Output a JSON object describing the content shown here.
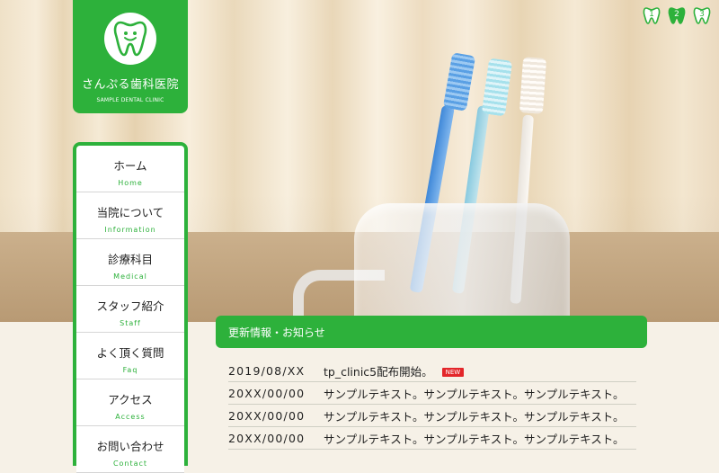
{
  "clinic": {
    "name": "さんぷる歯科医院",
    "subtitle": "SAMPLE DENTAL CLINIC"
  },
  "slider": {
    "pages": [
      "1",
      "2",
      "3"
    ],
    "active_index": 1
  },
  "nav": {
    "items": [
      {
        "jp": "ホーム",
        "en": "Home"
      },
      {
        "jp": "当院について",
        "en": "Information"
      },
      {
        "jp": "診療科目",
        "en": "Medical"
      },
      {
        "jp": "スタッフ紹介",
        "en": "Staff"
      },
      {
        "jp": "よく頂く質問",
        "en": "Faq"
      },
      {
        "jp": "アクセス",
        "en": "Access"
      },
      {
        "jp": "お問い合わせ",
        "en": "Contact"
      }
    ]
  },
  "news": {
    "title": "更新情報・お知らせ",
    "badge": "NEW",
    "items": [
      {
        "date": "2019/08/XX",
        "text": "tp_clinic5配布開始。",
        "is_new": true
      },
      {
        "date": "20XX/00/00",
        "text": "サンプルテキスト。サンプルテキスト。サンプルテキスト。",
        "is_new": false
      },
      {
        "date": "20XX/00/00",
        "text": "サンプルテキスト。サンプルテキスト。サンプルテキスト。",
        "is_new": false
      },
      {
        "date": "20XX/00/00",
        "text": "サンプルテキスト。サンプルテキスト。サンプルテキスト。",
        "is_new": false
      }
    ]
  },
  "colors": {
    "brand_green": "#2db13b",
    "new_badge_red": "#e3262a"
  }
}
